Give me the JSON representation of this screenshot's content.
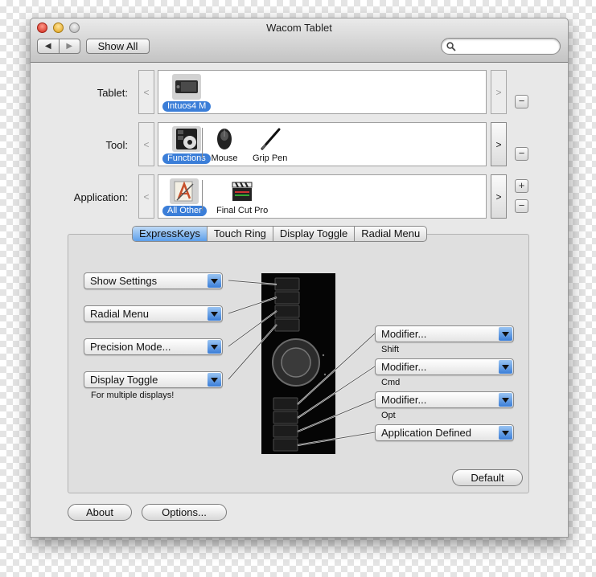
{
  "window": {
    "title": "Wacom Tablet"
  },
  "toolbar": {
    "back_glyph": "◀",
    "forward_glyph": "▶",
    "show_all_label": "Show All",
    "search_placeholder": ""
  },
  "tablet_row": {
    "label": "Tablet:",
    "prev_glyph": "<",
    "next_glyph": ">",
    "items": [
      {
        "name": "Intuos4 M",
        "selected": true,
        "icon": "tablet-icon"
      }
    ],
    "remove_label": "−"
  },
  "tool_row": {
    "label": "Tool:",
    "prev_glyph": "<",
    "next_glyph": ">",
    "items": [
      {
        "name": "Functions",
        "selected": true,
        "icon": "functions-icon"
      },
      {
        "name": "Mouse",
        "selected": false,
        "icon": "mouse-icon"
      },
      {
        "name": "Grip Pen",
        "selected": false,
        "icon": "pen-icon"
      }
    ],
    "remove_label": "−"
  },
  "application_row": {
    "label": "Application:",
    "prev_glyph": "<",
    "next_glyph": ">",
    "items": [
      {
        "name": "All Other",
        "selected": true,
        "icon": "applications-icon"
      },
      {
        "name": "Final Cut Pro",
        "selected": false,
        "icon": "clapper-icon"
      }
    ],
    "add_label": "+",
    "remove_label": "−"
  },
  "tabs": [
    {
      "label": "ExpressKeys",
      "active": true
    },
    {
      "label": "Touch Ring",
      "active": false
    },
    {
      "label": "Display Toggle",
      "active": false
    },
    {
      "label": "Radial Menu",
      "active": false
    }
  ],
  "left_keys": [
    {
      "value": "Show Settings"
    },
    {
      "value": "Radial Menu"
    },
    {
      "value": "Precision Mode..."
    },
    {
      "value": "Display Toggle",
      "note": "For multiple displays!"
    }
  ],
  "right_keys": [
    {
      "value": "Modifier...",
      "note": "Shift"
    },
    {
      "value": "Modifier...",
      "note": "Cmd"
    },
    {
      "value": "Modifier...",
      "note": "Opt"
    },
    {
      "value": "Application Defined"
    }
  ],
  "buttons": {
    "default": "Default",
    "about": "About",
    "options": "Options..."
  },
  "colors": {
    "selection": "#3b7ed8",
    "tab_active": "#5d9fea",
    "tablet": "#050505"
  }
}
